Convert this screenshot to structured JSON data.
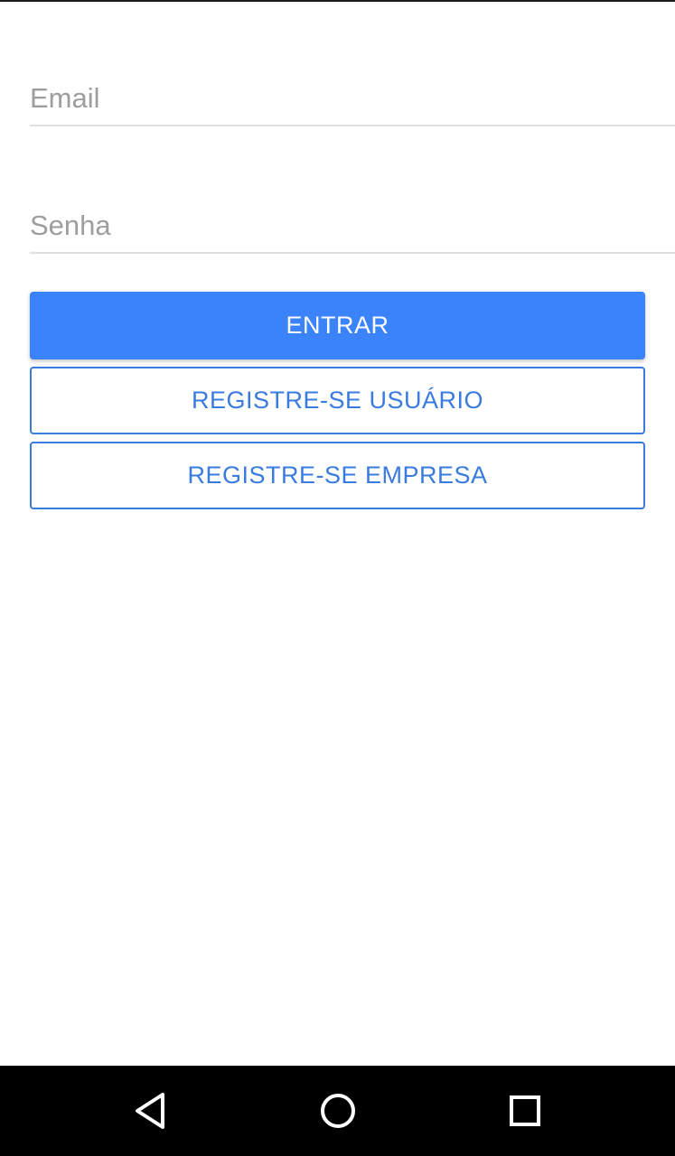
{
  "form": {
    "email_placeholder": "Email",
    "email_value": "",
    "password_placeholder": "Senha",
    "password_value": ""
  },
  "buttons": {
    "login_label": "ENTRAR",
    "register_user_label": "REGISTRE-SE USUÁRIO",
    "register_company_label": "REGISTRE-SE EMPRESA"
  },
  "colors": {
    "primary": "#3a83fa",
    "outline": "#3a7be0",
    "background": "#ffffff",
    "navbar": "#000000"
  },
  "navbar": {
    "back_icon": "back-triangle-icon",
    "home_icon": "home-circle-icon",
    "recent_icon": "recent-apps-square-icon"
  }
}
